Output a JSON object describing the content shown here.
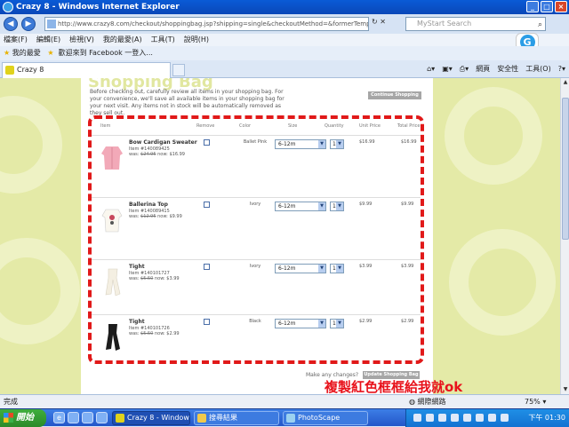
{
  "window": {
    "title": "Crazy 8 - Windows Internet Explorer"
  },
  "address": {
    "url": "http://www.crazy8.com/checkout/shoppingbag.jsp?shipping=single&checkoutMethod=&formerTemplate=check"
  },
  "search": {
    "placeholder": "MyStart Search"
  },
  "menu": [
    "檔案(F)",
    "編輯(E)",
    "檢視(V)",
    "我的最愛(A)",
    "工具(T)",
    "說明(H)"
  ],
  "favorites": {
    "label": "我的最愛",
    "link": "歡迎來到 Facebook 一登入..."
  },
  "tab": {
    "title": "Crazy 8"
  },
  "commandbar": {
    "page": "網頁",
    "safety": "安全性",
    "tools": "工具(O)"
  },
  "page": {
    "heading": "Shopping Bag",
    "intro": "Before checking out, carefully review all items in your shopping bag. For your convenience, we'll save all available items in your shopping bag for your next visit. Any items not in stock will be automatically removed as they sell out.",
    "continue_label": "Continue Shopping",
    "columns": {
      "item": "Item",
      "remove": "Remove",
      "color": "Color",
      "size": "Size",
      "quantity": "Quantity",
      "unit": "Unit Price",
      "total": "Total Price"
    },
    "items": [
      {
        "name": "Bow Cardigan Sweater",
        "number": "Item #140089425",
        "was_label": "was:",
        "was": "$24.95",
        "now": "now: $16.99",
        "color": "Ballet Pink",
        "size": "6-12m",
        "qty": "1",
        "unit": "$16.99",
        "total": "$16.99"
      },
      {
        "name": "Ballerina Top",
        "number": "Item #140089415",
        "was_label": "was:",
        "was": "$12.95",
        "now": "now: $9.99",
        "color": "Ivory",
        "size": "6-12m",
        "qty": "1",
        "unit": "$9.99",
        "total": "$9.99"
      },
      {
        "name": "Tight",
        "number": "Item #140101727",
        "was_label": "was:",
        "was": "$5.50",
        "now": "now: $3.99",
        "color": "Ivory",
        "size": "6-12m",
        "qty": "1",
        "unit": "$3.99",
        "total": "$3.99"
      },
      {
        "name": "Tight",
        "number": "Item #140101726",
        "was_label": "was:",
        "was": "$5.50",
        "now": "now: $2.99",
        "color": "Black",
        "size": "6-12m",
        "qty": "1",
        "unit": "$2.99",
        "total": "$2.99"
      }
    ],
    "changes_label": "Make any changes?",
    "update_label": "Update Shopping Bag"
  },
  "annotation": "複製紅色框框給我就ok",
  "status": {
    "text": "完成",
    "zone": "網際網路",
    "zoom": "75%"
  },
  "taskbar": {
    "start": "開始",
    "buttons": [
      "Crazy 8 - Windows I...",
      "搜尋結果",
      "PhotoScape"
    ],
    "clock": "下午 01:30"
  }
}
